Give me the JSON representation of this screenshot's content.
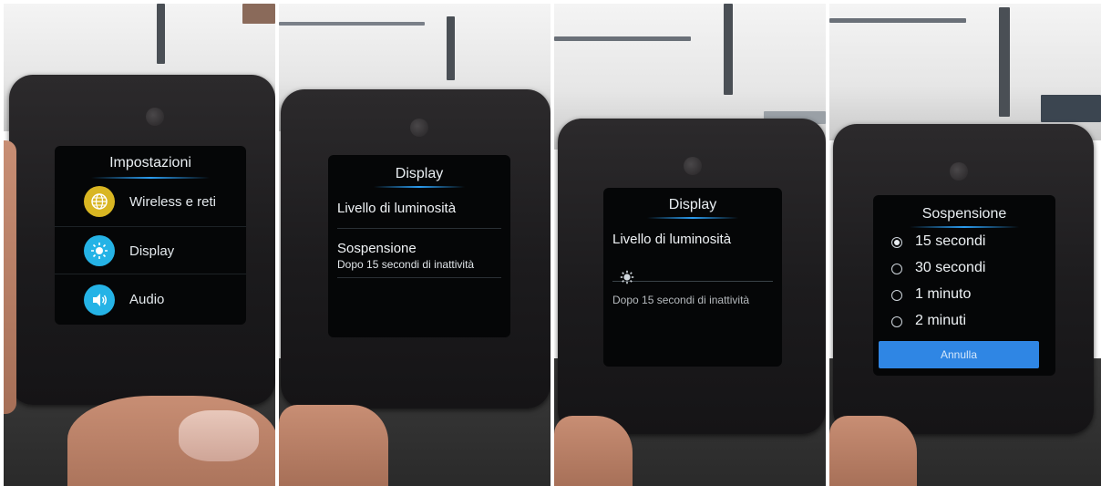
{
  "panels": [
    {
      "title": "Impostazioni",
      "items": [
        {
          "label": "Wireless e reti",
          "icon": "globe-icon",
          "color": "#d9b622"
        },
        {
          "label": "Display",
          "icon": "brightness-icon",
          "color": "#25b3e6"
        },
        {
          "label": "Audio",
          "icon": "speaker-icon",
          "color": "#25b3e6"
        }
      ]
    },
    {
      "title": "Display",
      "items": [
        {
          "title": "Livello di luminosità",
          "subtitle": ""
        },
        {
          "title": "Sospensione",
          "subtitle": "Dopo 15 secondi di inattività"
        }
      ]
    },
    {
      "title": "Display",
      "item_title": "Livello di luminosità",
      "slider_icon": "brightness-icon",
      "hidden_text": "Dopo 15 secondi di inattività"
    },
    {
      "title": "Sospensione",
      "options": [
        "15 secondi",
        "30 secondi",
        "1 minuto",
        "2 minuti"
      ],
      "selected_index": 0,
      "cancel_label": "Annulla"
    }
  ],
  "colors": {
    "accent": "#2b9df0",
    "button": "#2f86e4",
    "screen": "#050607"
  }
}
